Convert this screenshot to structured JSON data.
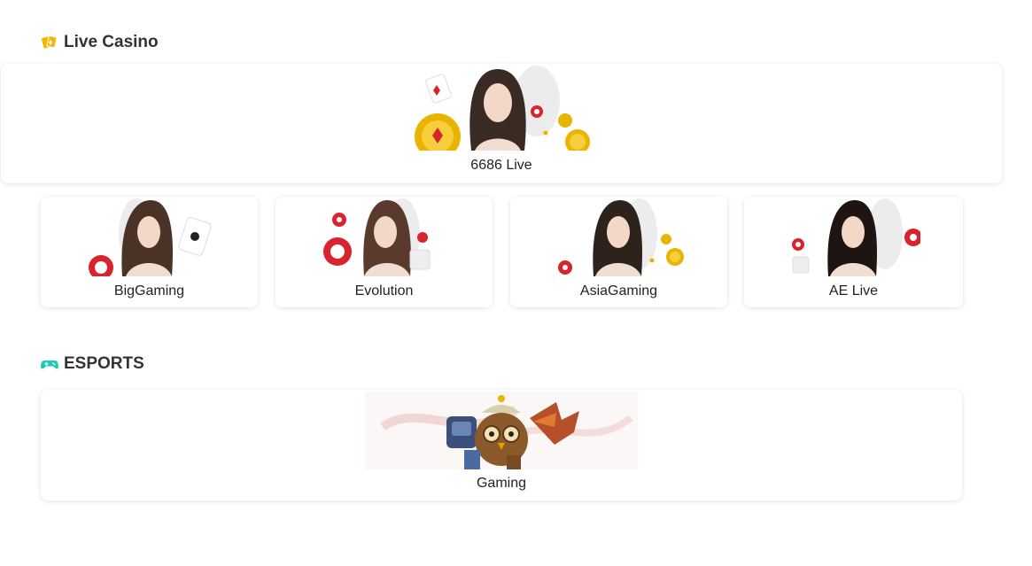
{
  "live_casino": {
    "title": "Live Casino",
    "icon": "cards-icon",
    "featured": {
      "label": "6686 Live"
    },
    "providers": [
      {
        "label": "BigGaming"
      },
      {
        "label": "Evolution"
      },
      {
        "label": "AsiaGaming"
      },
      {
        "label": "AE Live"
      }
    ]
  },
  "esports": {
    "title": "ESPORTS",
    "icon": "gamepad-icon",
    "featured": {
      "label": "Gaming"
    }
  },
  "colors": {
    "casino_icon": "#f5b800",
    "esports_icon": "#1fc8b8",
    "chip_red": "#d9232e",
    "gold": "#e8b400"
  }
}
